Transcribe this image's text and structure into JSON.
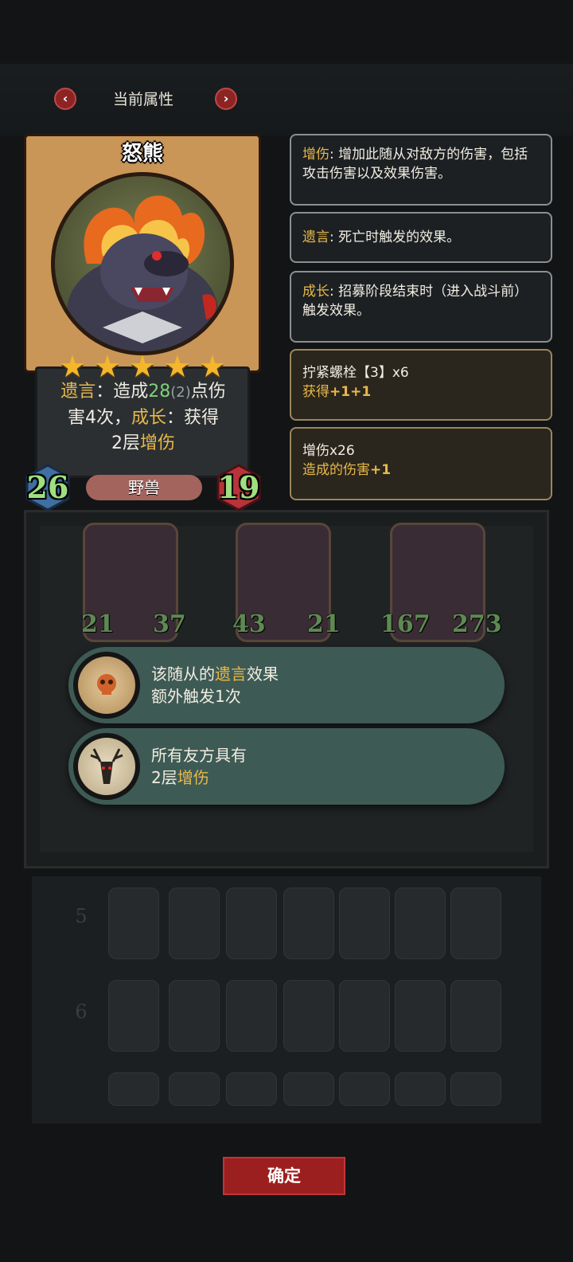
{
  "header": {
    "title": "当前属性",
    "prev_icon": "chevron-left-icon",
    "next_icon": "chevron-right-icon",
    "prev_glyph": "‹",
    "next_glyph": "›"
  },
  "card": {
    "name": "怒熊",
    "stars": 5,
    "desc_line1_a": "遗言",
    "desc_line1_b": "：造成",
    "desc_line1_c": "28",
    "desc_line1_d": "(2)",
    "desc_line1_e": "点伤",
    "desc_line2_a": "害4次，",
    "desc_line2_b": "成长",
    "desc_line2_c": "：获得",
    "desc_line3_a": "2层",
    "desc_line3_b": "增伤",
    "attack": "26",
    "health": "19",
    "tribe": "野兽"
  },
  "info_boxes": [
    {
      "keyword": "增伤",
      "text": ": 增加此随从对敌方的伤害，包括攻击伤害以及效果伤害。"
    },
    {
      "keyword": "遗言",
      "text": ": 死亡时触发的效果。"
    },
    {
      "keyword": "成长",
      "text": ": 招募阶段结束时（进入战斗前）触发效果。"
    }
  ],
  "buff_boxes": [
    {
      "title": "拧紧螺栓【3】x6",
      "sub": "获得",
      "sub_val": "+1+1"
    },
    {
      "title": "增伤x26",
      "sub": "造成的伤害",
      "sub_val": "+1"
    }
  ],
  "board_minions": [
    {
      "attack": "21",
      "health": "37"
    },
    {
      "attack": "43",
      "health": "21"
    },
    {
      "attack": "167",
      "health": "273"
    }
  ],
  "popups": [
    {
      "line1_a": "该随从的",
      "line1_b": "遗言",
      "line1_c": "效果",
      "line2": "额外触发1次"
    },
    {
      "line1": "所有友方具有",
      "line2_a": "2层",
      "line2_b": "增伤"
    }
  ],
  "roster_rows": [
    "5",
    "6"
  ],
  "confirm_label": "确定",
  "colors": {
    "keyword": "#e8b84a",
    "buff_value": "#e8b84a",
    "attack": "#9ee07f",
    "confirm": "#9c1f1f"
  }
}
